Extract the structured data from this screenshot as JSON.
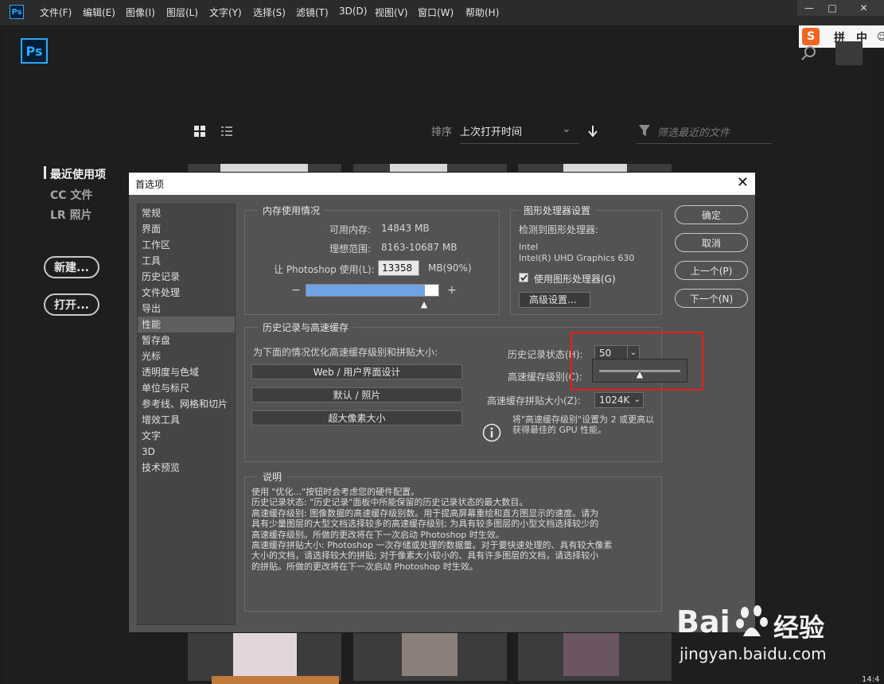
{
  "menubar": {
    "app_icon": "Ps",
    "items": [
      "文件(F)",
      "编辑(E)",
      "图像(I)",
      "图层(L)",
      "文字(Y)",
      "选择(S)",
      "滤镜(T)",
      "3D(D)",
      "视图(V)",
      "窗口(W)",
      "帮助(H)"
    ],
    "window_controls": {
      "minimize": "—",
      "maximize": "□",
      "close": "✕"
    }
  },
  "ime": {
    "logo": "S",
    "items": [
      "拼",
      "中"
    ]
  },
  "home": {
    "logo": "Ps",
    "sort_label": "排序",
    "sort_value": "上次打开时间",
    "filter_placeholder": "筛选最近的文件",
    "sidebar": {
      "links": [
        "最近使用项",
        "CC 文件",
        "LR 照片"
      ],
      "buttons": [
        "新建...",
        "打开..."
      ]
    }
  },
  "dialog": {
    "title": "首选项",
    "categories": [
      "常规",
      "界面",
      "工作区",
      "工具",
      "历史记录",
      "文件处理",
      "导出",
      "性能",
      "暂存盘",
      "光标",
      "透明度与色域",
      "单位与标尺",
      "参考线、网格和切片",
      "增效工具",
      "文字",
      "3D",
      "技术预览"
    ],
    "selected_category": "性能",
    "buttons": [
      "确定",
      "取消",
      "上一个(P)",
      "下一个(N)"
    ],
    "memory": {
      "title": "内存使用情况",
      "available_label": "可用内存:",
      "available_value": "14843 MB",
      "ideal_label": "理想范围:",
      "ideal_value": "8163-10687 MB",
      "let_label": "让 Photoshop 使用(L):",
      "let_value": "13358",
      "unit": "MB(90%)",
      "minus": "−",
      "plus": "+",
      "slider_fraction": 0.9
    },
    "gpu": {
      "title": "图形处理器设置",
      "detected_label": "检测到图形处理器:",
      "vendor": "Intel",
      "model": "Intel(R) UHD Graphics 630",
      "use_gpu_label": "使用图形处理器(G)",
      "use_gpu_checked": true,
      "advanced_button": "高级设置..."
    },
    "history_cache": {
      "title": "历史记录与高速缓存",
      "optimize_label": "为下面的情况优化高速缓存级别和拼贴大小:",
      "presets": [
        "Web / 用户界面设计",
        "默认 / 照片",
        "超大像素大小"
      ],
      "history_states_label": "历史记录状态(H):",
      "history_states_value": "50",
      "cache_levels_label": "高速缓存级别(C):",
      "cache_tile_label": "高速缓存拼贴大小(Z):",
      "cache_tile_value": "1024K",
      "tip": "将\"高速缓存级别\"设置为 2 或更高以获得最佳的 GPU 性能。",
      "popup_slider_fraction": 0.5
    },
    "description": {
      "title": "说明",
      "lines": [
        "使用 \"优化...\"按钮时会考虑您的硬件配置。",
        "历史记录状态: \"历史记录\"面板中所能保留的历史记录状态的最大数目。",
        "高速缓存级别: 图像数据的高速缓存级别数。用于提高屏幕重绘和直方图显示的速度。请为",
        "具有少量图层的大型文档选择较多的高速缓存级别; 为具有较多图层的小型文档选择较少的",
        "高速缓存级别。所做的更改将在下一次启动 Photoshop 时生效。",
        "高速缓存拼贴大小: Photoshop 一次存储或处理的数据量。对于要快速处理的、具有较大像素",
        "大小的文档，请选择较大的拼贴; 对于像素大小较小的、具有许多图层的文档，请选择较小",
        "的拼贴。所做的更改将在下一次启动 Photoshop 时生效。"
      ]
    }
  },
  "watermark": {
    "brand": "Bai",
    "brand2": "经验",
    "url": "jingyan.baidu.com"
  },
  "taskbar_clock": "14:4"
}
